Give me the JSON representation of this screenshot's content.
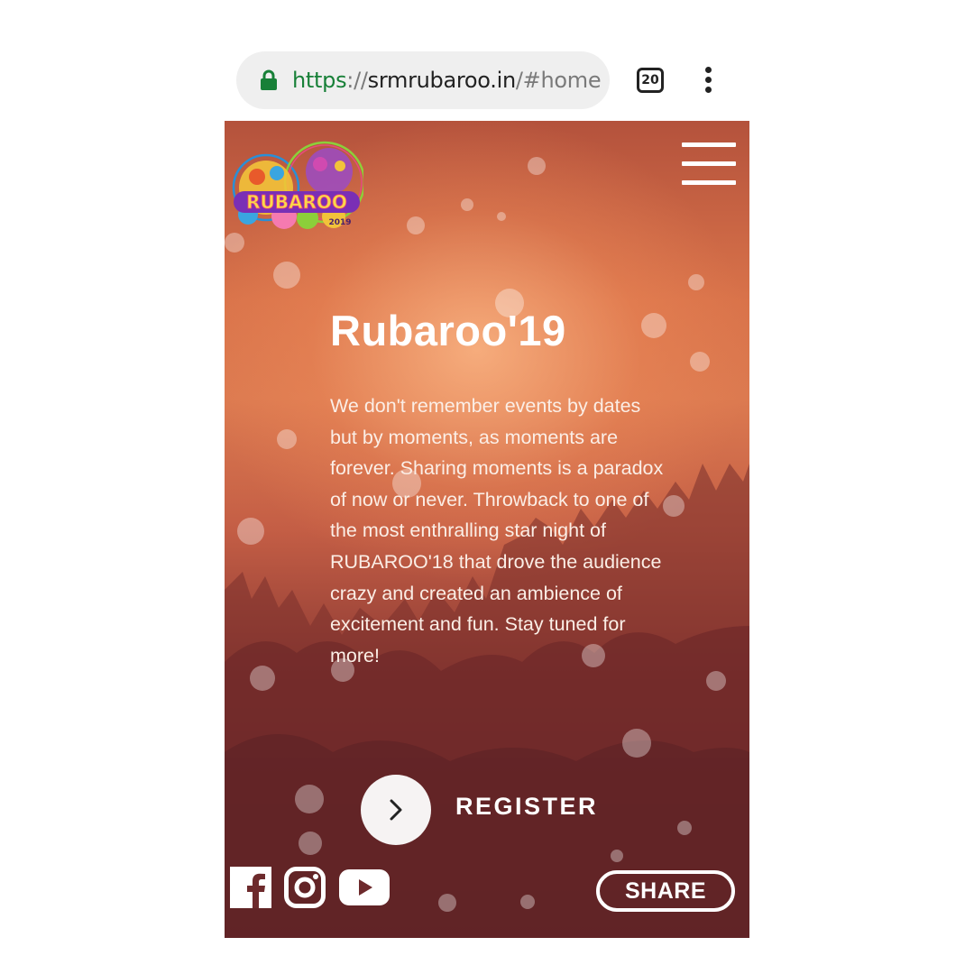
{
  "browser": {
    "url_scheme": "https",
    "url_separator": "://",
    "url_host": "srmrubaroo.in",
    "url_hash": "/#home",
    "tab_count": "20",
    "menu_icon": "more-vert-icon",
    "lock_icon": "lock-icon",
    "colors": {
      "secure": "#188038",
      "bar": "#efefef"
    }
  },
  "page": {
    "logo": {
      "text": "RUBAROO",
      "year": "2019"
    },
    "menu_icon": "hamburger-icon",
    "title": "Rubaroo'19",
    "description": "We don't remember events by dates but by moments, as moments are forever. Sharing moments is a paradox of now or never. Throwback to one of the most enthralling star night of RUBAROO'18 that drove the audience crazy and created an ambience of excitement and fun. Stay tuned for more!",
    "register": {
      "label": "REGISTER",
      "icon": "chevron-right-icon"
    },
    "social": [
      {
        "name": "Facebook",
        "icon": "facebook-icon"
      },
      {
        "name": "Instagram",
        "icon": "instagram-icon"
      },
      {
        "name": "YouTube",
        "icon": "youtube-icon"
      }
    ],
    "share_label": "SHARE",
    "colors": {
      "hero_top": "#d9734a",
      "hero_bottom": "#5e2528",
      "text": "#ffffff"
    }
  }
}
